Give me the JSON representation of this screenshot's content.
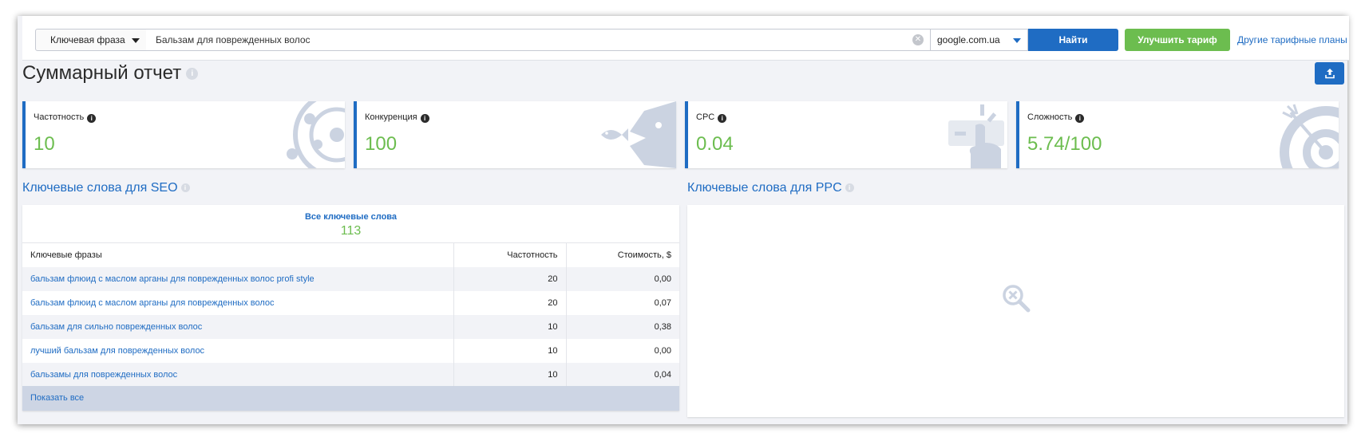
{
  "search": {
    "type_label": "Ключевая фраза",
    "query": "Бальзам для поврежденных волос",
    "engine": "google.com.ua",
    "find_label": "Найти",
    "upgrade_label": "Улучшить тариф",
    "plans_label": "Другие тарифные планы"
  },
  "page": {
    "title": "Суммарный отчет"
  },
  "metrics": [
    {
      "label": "Частотность",
      "value": "10",
      "icon": "orbit-icon"
    },
    {
      "label": "Конкуренция",
      "value": "100",
      "icon": "big-fish-small-fish-icon"
    },
    {
      "label": "CPC",
      "value": "0.04",
      "icon": "click-hand-icon"
    },
    {
      "label": "Сложность",
      "value": "5.74/100",
      "icon": "target-arrow-icon"
    }
  ],
  "seo": {
    "title": "Ключевые слова для SEO",
    "all_keywords_label": "Все ключевые слова",
    "all_keywords_count": "113",
    "columns": [
      "Ключевые фразы",
      "Частотность",
      "Стоимость, $"
    ],
    "rows": [
      {
        "phrase": "бальзам флюид с маслом арганы для поврежденных волос profi style",
        "freq": "20",
        "cost": "0,00"
      },
      {
        "phrase": "бальзам флюид с маслом арганы для поврежденных волос",
        "freq": "20",
        "cost": "0,07"
      },
      {
        "phrase": "бальзам для сильно поврежденных волос",
        "freq": "10",
        "cost": "0,38"
      },
      {
        "phrase": "лучший бальзам для поврежденных волос",
        "freq": "10",
        "cost": "0,00"
      },
      {
        "phrase": "бальзамы для поврежденных волос",
        "freq": "10",
        "cost": "0,04"
      }
    ],
    "show_all_label": "Показать все"
  },
  "ppc": {
    "title": "Ключевые слова для PPC",
    "empty_icon": "no-results-magnifier-icon"
  },
  "colors": {
    "accent": "#1f6cc3",
    "green": "#6cbd4f",
    "background": "#f2f3f7"
  }
}
